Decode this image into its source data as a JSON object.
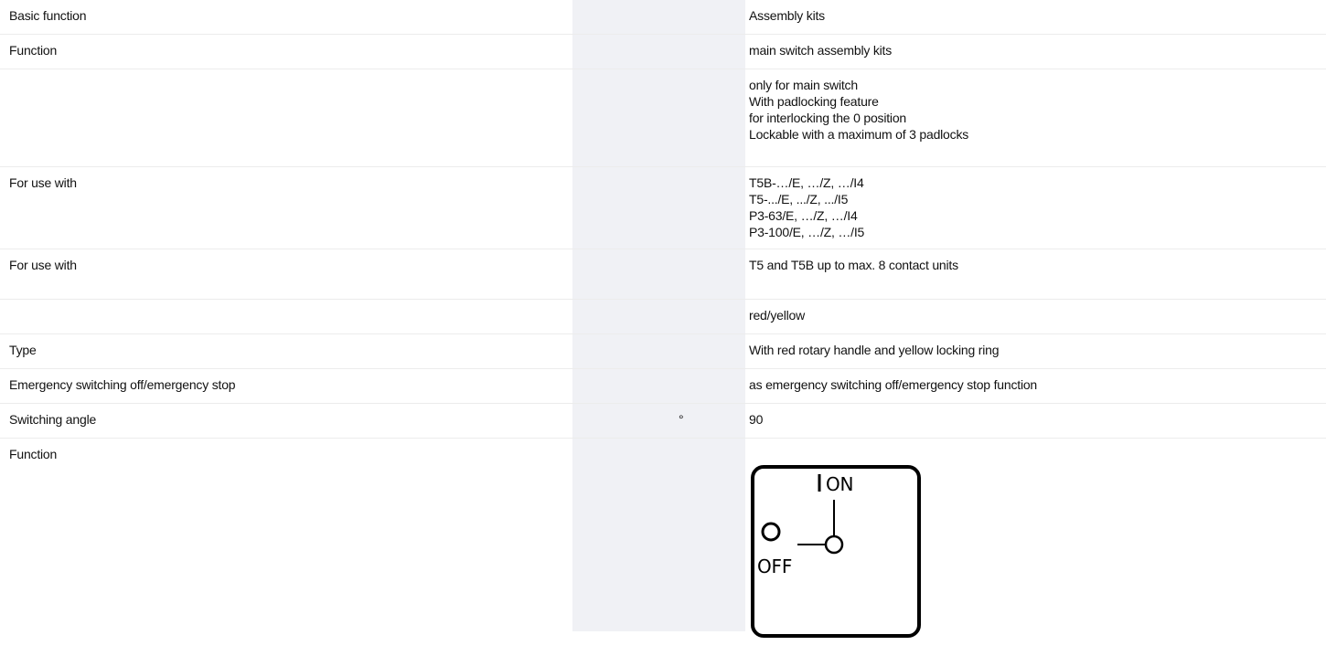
{
  "rows": [
    {
      "label": "Basic function",
      "unit": "",
      "value": "Assembly kits"
    },
    {
      "label": "Function",
      "unit": "",
      "value": "main switch assembly kits"
    },
    {
      "label": "",
      "unit": "",
      "value": "only for main switch\nWith padlocking feature\nfor interlocking the 0 position\nLockable with a maximum of 3 padlocks"
    },
    {
      "label": "For use with",
      "unit": "",
      "value": "T5B-…/E, …/Z, …/I4\nT5-.../E, .../Z, .../I5\nP3-63/E, …/Z, …/I4\nP3-100/E, …/Z, …/I5"
    },
    {
      "label": "For use with",
      "unit": "",
      "value": "T5 and T5B up to max. 8 contact units"
    },
    {
      "label": "",
      "unit": "",
      "value": "red/yellow"
    },
    {
      "label": "Type",
      "unit": "",
      "value": "With red rotary handle and yellow locking ring"
    },
    {
      "label": "Emergency switching off/emergency stop",
      "unit": "",
      "value": "as emergency switching off/emergency stop function"
    },
    {
      "label": "Switching angle",
      "unit": "°",
      "value": "90"
    },
    {
      "label": "Function",
      "unit": "",
      "value": ""
    }
  ],
  "diagram": {
    "on_label": "ON",
    "off_label": "OFF"
  }
}
